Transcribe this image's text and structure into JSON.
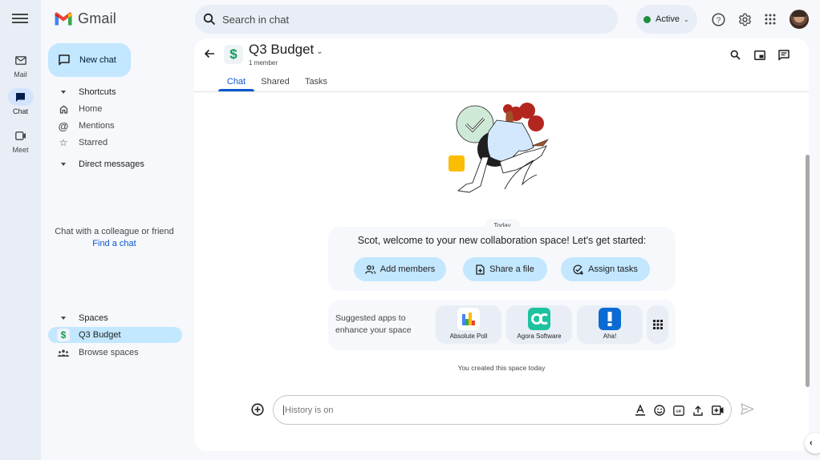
{
  "app": {
    "name": "Gmail"
  },
  "rail": {
    "items": [
      {
        "label": "Mail",
        "icon": "mail-icon"
      },
      {
        "label": "Chat",
        "icon": "chat-icon",
        "active": true
      },
      {
        "label": "Meet",
        "icon": "video-icon"
      }
    ]
  },
  "nav": {
    "new_chat_label": "New chat",
    "shortcuts": {
      "label": "Shortcuts",
      "items": [
        {
          "label": "Home",
          "icon": "home-icon"
        },
        {
          "label": "Mentions",
          "icon": "at-icon"
        },
        {
          "label": "Starred",
          "icon": "star-icon"
        }
      ]
    },
    "direct_messages": {
      "label": "Direct messages",
      "empty_text": "Chat with a colleague or friend",
      "find_link": "Find a chat"
    },
    "spaces": {
      "label": "Spaces",
      "items": [
        {
          "label": "Q3 Budget",
          "icon": "$",
          "selected": true
        },
        {
          "label": "Browse spaces",
          "icon": "people-icon"
        }
      ]
    }
  },
  "topbar": {
    "search_placeholder": "Search in chat",
    "status_label": "Active",
    "status_color": "#1e8e3e"
  },
  "space": {
    "icon": "$",
    "title": "Q3 Budget",
    "members": "1 member",
    "tabs": [
      {
        "label": "Chat",
        "active": true
      },
      {
        "label": "Shared"
      },
      {
        "label": "Tasks"
      }
    ]
  },
  "conversation": {
    "date_divider": "Today",
    "welcome_text": "Scot, welcome to your new collaboration space! Let's get started:",
    "actions": [
      {
        "label": "Add members",
        "icon": "add-person-icon"
      },
      {
        "label": "Share a file",
        "icon": "file-add-icon"
      },
      {
        "label": "Assign tasks",
        "icon": "add-task-icon"
      }
    ],
    "suggested_apps_text": "Suggested apps to enhance your space",
    "apps": [
      {
        "name": "Absolute Poll"
      },
      {
        "name": "Agora Software"
      },
      {
        "name": "Aha!"
      }
    ],
    "created_text": "You created this space today"
  },
  "composer": {
    "placeholder": "History is on"
  },
  "colors": {
    "accent": "#0b57d0",
    "pill": "#c2e7ff",
    "space_icon": "#0f9d58"
  }
}
